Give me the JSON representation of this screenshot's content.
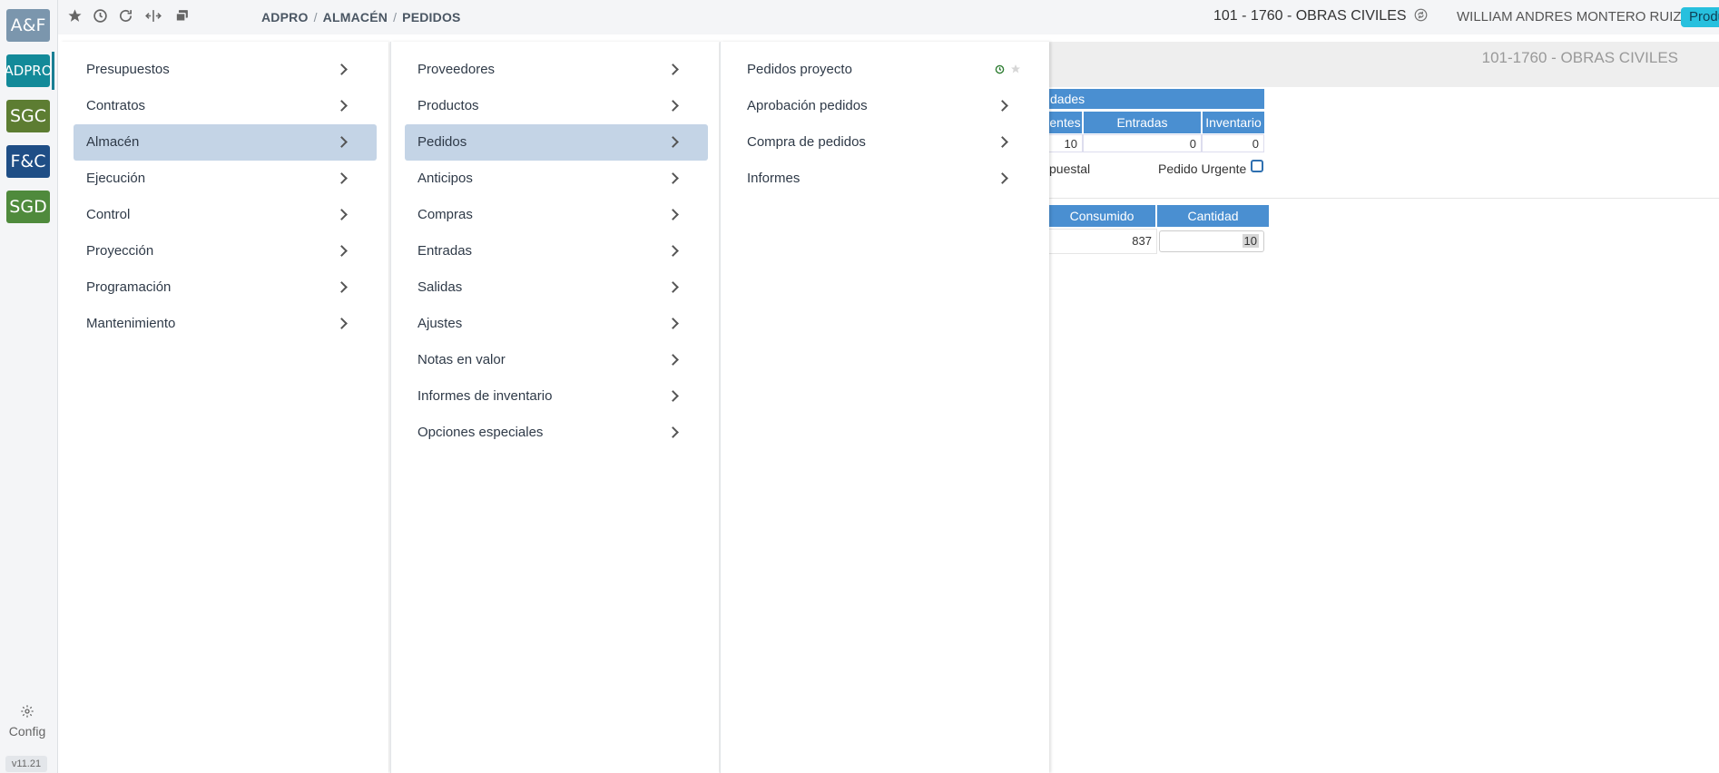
{
  "app_rail": {
    "apps": [
      {
        "label": "A&F",
        "color": "#7b96ad"
      },
      {
        "label": "ADPRO",
        "color": "#138a99"
      },
      {
        "label": "SGC",
        "color": "#5d7d32"
      },
      {
        "label": "F&C",
        "color": "#1f4e86"
      },
      {
        "label": "SGD",
        "color": "#4f8a3c"
      }
    ],
    "config_label": "Config",
    "version": "v11.21"
  },
  "topbar": {
    "icons": [
      "star-icon",
      "history-icon",
      "refresh-icon",
      "split-icon",
      "windows-icon"
    ],
    "breadcrumb": [
      "ADPRO",
      "ALMACÉN",
      "PEDIDOS"
    ],
    "project": "101 - 1760 - OBRAS CIVILES",
    "user": "WILLIAM ANDRES MONTERO RUIZ",
    "environment": "Producción"
  },
  "background": {
    "header_title": "101-1760 - OBRAS CIVILES",
    "section_label": "dades",
    "table_headers": [
      "entes",
      "Entradas Pendientes",
      "Inventario"
    ],
    "table_values": [
      "10",
      "0",
      "0"
    ],
    "left_text": "puestal",
    "urgent_label": "Pedido Urgente",
    "table2_headers": [
      "Consumido",
      "Cantidad"
    ],
    "table2_values": [
      "837",
      "10"
    ]
  },
  "menu": {
    "level1": [
      {
        "label": "Presupuestos",
        "selected": false
      },
      {
        "label": "Contratos",
        "selected": false
      },
      {
        "label": "Almacén",
        "selected": true
      },
      {
        "label": "Ejecución",
        "selected": false
      },
      {
        "label": "Control",
        "selected": false
      },
      {
        "label": "Proyección",
        "selected": false
      },
      {
        "label": "Programación",
        "selected": false
      },
      {
        "label": "Mantenimiento",
        "selected": false
      }
    ],
    "level2": [
      {
        "label": "Proveedores",
        "selected": false
      },
      {
        "label": "Productos",
        "selected": false
      },
      {
        "label": "Pedidos",
        "selected": true
      },
      {
        "label": "Anticipos",
        "selected": false
      },
      {
        "label": "Compras",
        "selected": false
      },
      {
        "label": "Entradas",
        "selected": false
      },
      {
        "label": "Salidas",
        "selected": false
      },
      {
        "label": "Ajustes",
        "selected": false
      },
      {
        "label": "Notas en valor",
        "selected": false
      },
      {
        "label": "Informes de inventario",
        "selected": false
      },
      {
        "label": "Opciones especiales",
        "selected": false
      }
    ],
    "level3": [
      {
        "label": "Pedidos proyecto",
        "has_submenu": false
      },
      {
        "label": "Aprobación pedidos",
        "has_submenu": true
      },
      {
        "label": "Compra de pedidos",
        "has_submenu": true
      },
      {
        "label": "Informes",
        "has_submenu": true
      }
    ]
  }
}
